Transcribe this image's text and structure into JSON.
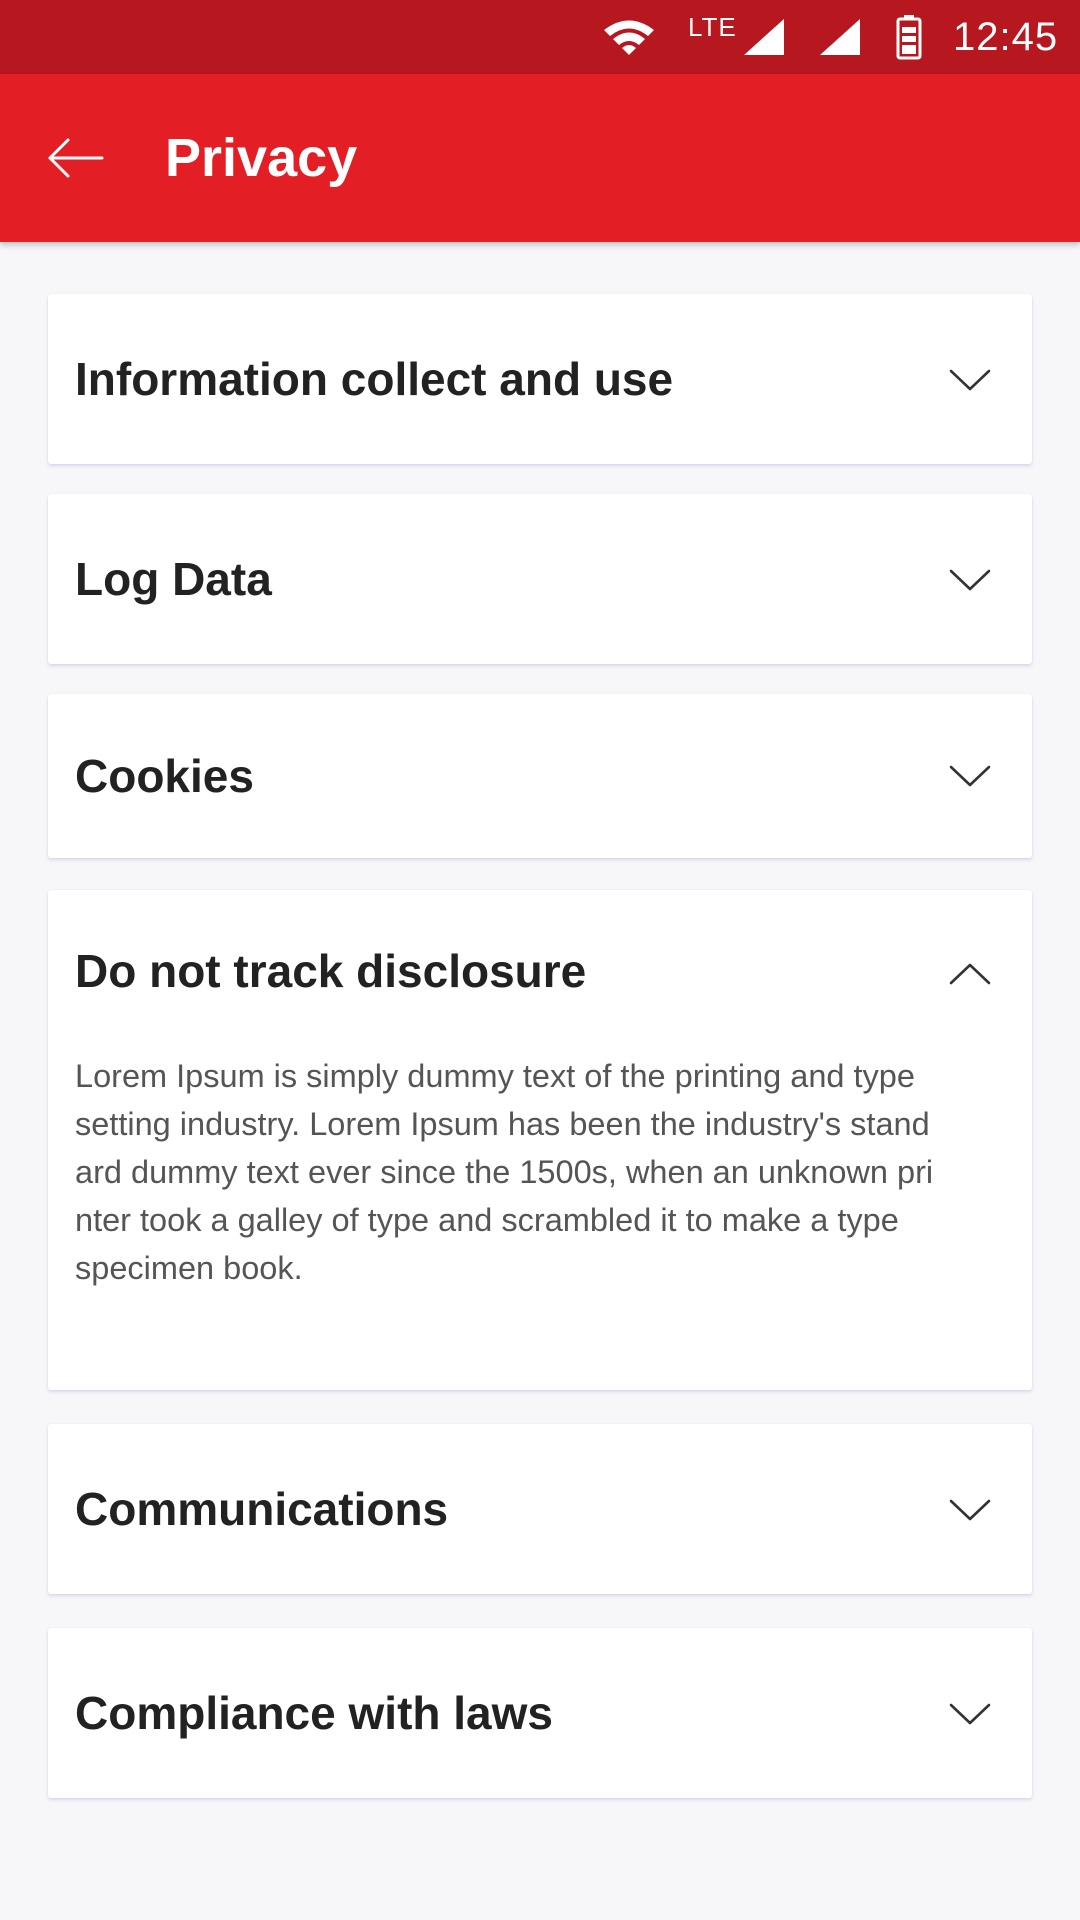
{
  "status_bar": {
    "network_label": "LTE",
    "time": "12:45",
    "icons": [
      "wifi-icon",
      "cell-signal-icon",
      "cell-signal-icon",
      "battery-icon"
    ]
  },
  "app_bar": {
    "title": "Privacy",
    "back_icon": "arrow-left-icon",
    "color": "#e31e25",
    "status_color": "#b7171e"
  },
  "sections": [
    {
      "title": "Information collect and use",
      "expanded": false
    },
    {
      "title": "Log Data",
      "expanded": false
    },
    {
      "title": "Cookies",
      "expanded": false
    },
    {
      "title": "Do not track disclosure",
      "expanded": true,
      "body": "Lorem Ipsum is simply dummy text of the printing and type\nsetting industry. Lorem Ipsum has been the industry's stand\nard dummy text ever since the 1500s, when an unknown pri\nnter took a galley of type and scrambled it to make a type\nspecimen book."
    },
    {
      "title": "Communications",
      "expanded": false
    },
    {
      "title": "Compliance with laws",
      "expanded": false
    }
  ]
}
